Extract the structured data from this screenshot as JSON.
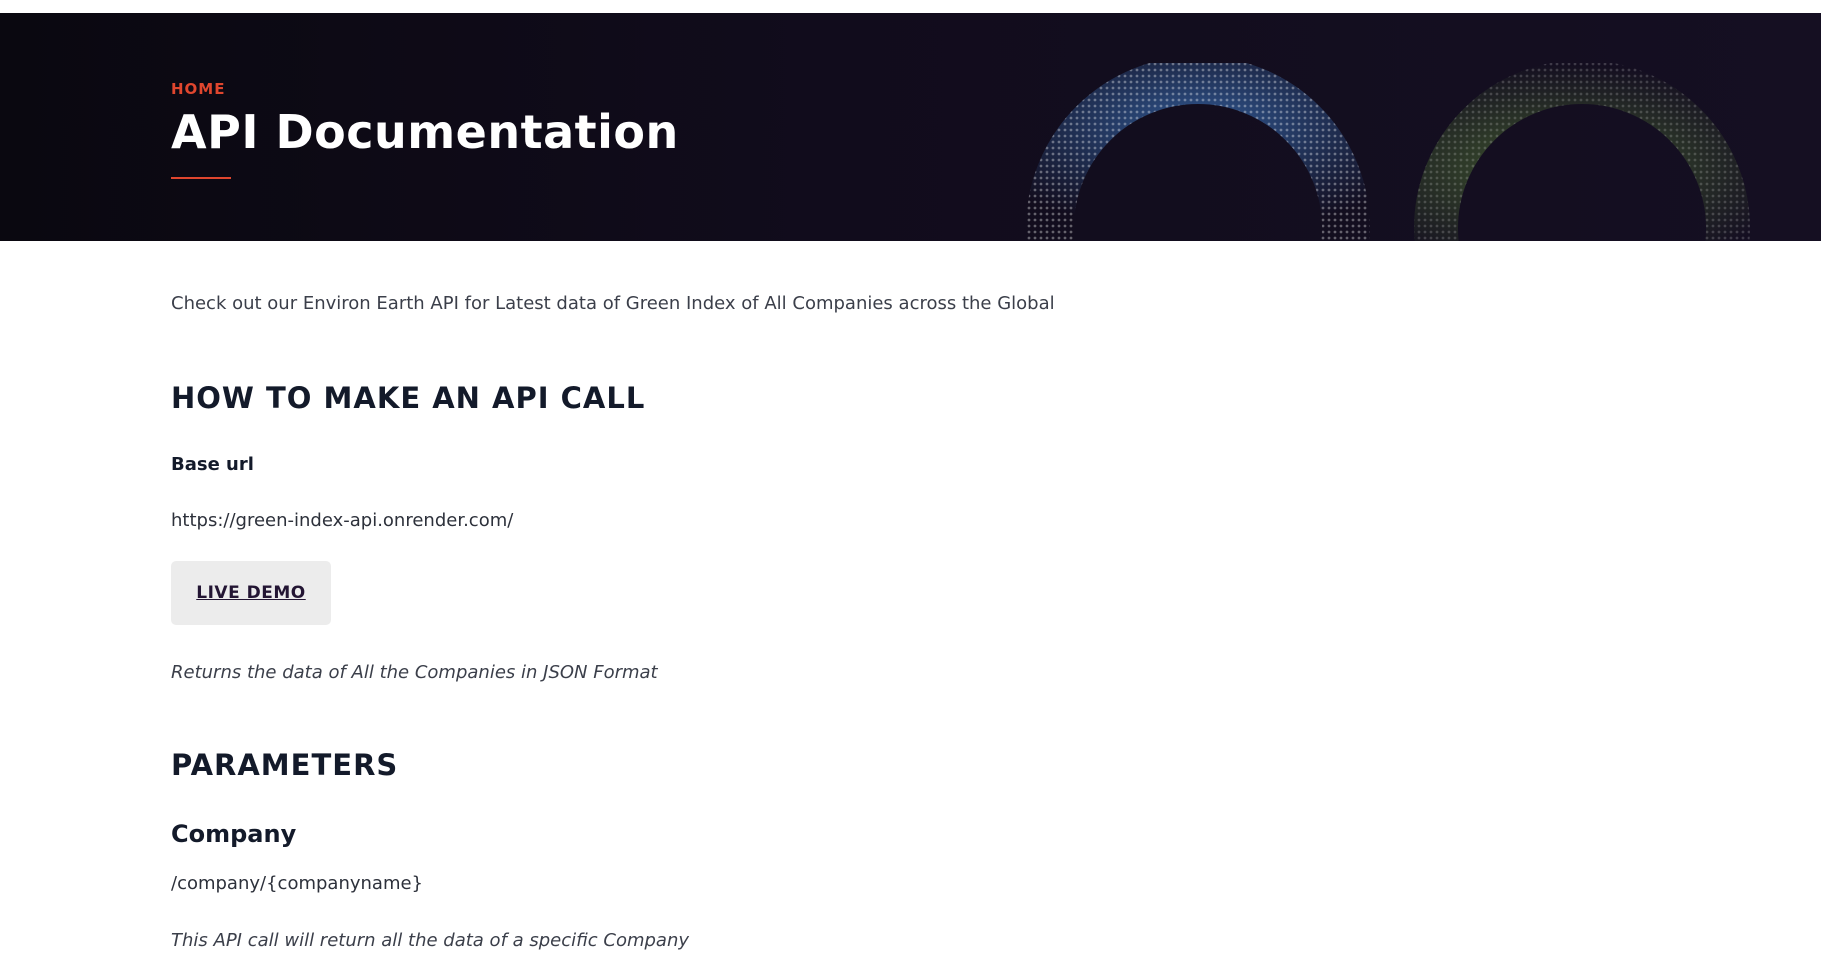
{
  "hero": {
    "breadcrumb": "HOME",
    "title": "API Documentation",
    "accent_color": "#e0462e"
  },
  "intro": "Check out our Environ Earth API for Latest data of Green Index of All Companies across the Global",
  "how_to": {
    "heading": "HOW TO MAKE AN API CALL",
    "base_url_label": "Base url",
    "base_url": "https://green-index-api.onrender.com/",
    "live_demo_label": "LIVE DEMO",
    "returns_note": "Returns the data of All the Companies in JSON Format"
  },
  "parameters": {
    "heading": "PARAMETERS",
    "company": {
      "title": "Company",
      "path": "/company/{companyname}",
      "note": "This API call will return all the data of a specific Company"
    }
  }
}
